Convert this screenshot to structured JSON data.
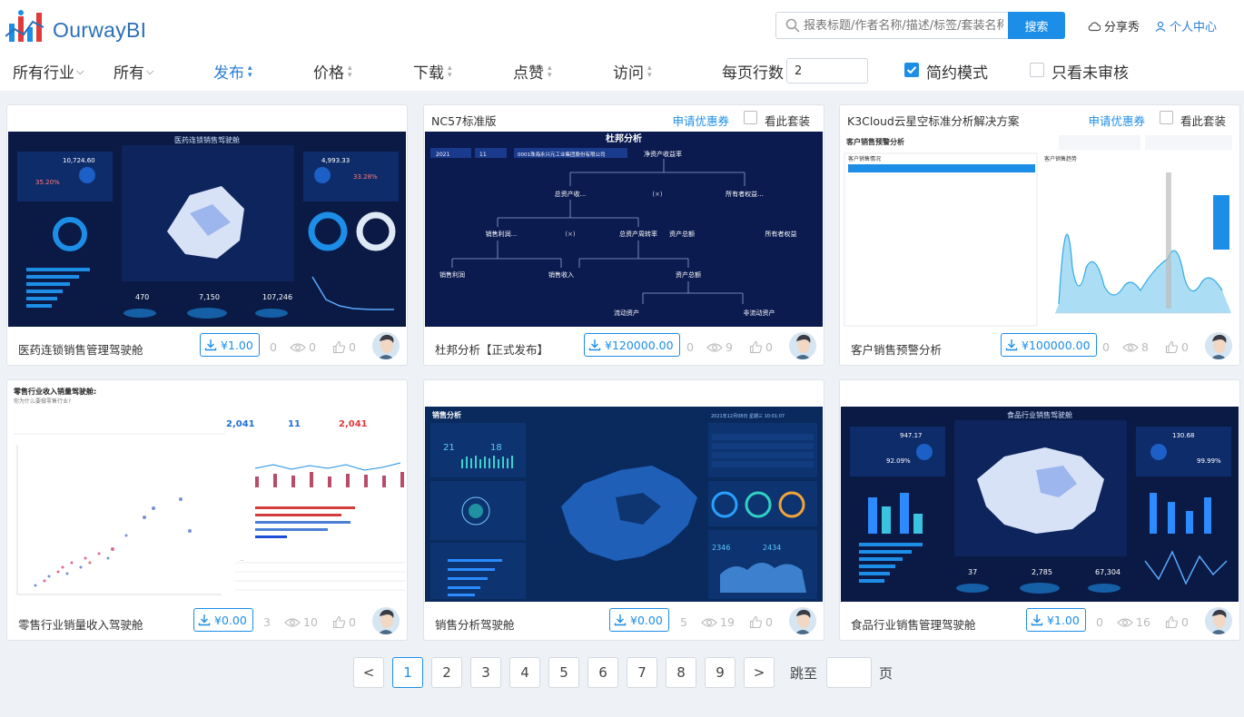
{
  "header": {
    "logo_text": "OurwayBI",
    "search_placeholder": "报表标题/作者名称/描述/标签/套装名称",
    "search_button": "搜索",
    "share_label": "分享秀",
    "personal_label": "个人中心"
  },
  "filters": {
    "industry": "所有行业",
    "all": "所有",
    "publish": "发布",
    "price": "价格",
    "download": "下载",
    "like": "点赞",
    "visit": "访问",
    "rows_label": "每页行数",
    "rows_value": "2",
    "simple_mode": "简约模式",
    "unreviewed": "只看未审核"
  },
  "cards": [
    {
      "header_title": "",
      "coupon": "",
      "see_set": "",
      "name": "医药连锁销售管理驾驶舱",
      "price": "¥1.00",
      "downloads": "0",
      "views": "0",
      "likes": "0"
    },
    {
      "header_title": "NC57标准版",
      "coupon": "申请优惠券",
      "see_set": "看此套装",
      "name": "杜邦分析【正式发布】",
      "price": "¥120000.00",
      "downloads": "0",
      "views": "9",
      "likes": "0"
    },
    {
      "header_title": "K3Cloud云星空标准分析解决方案",
      "coupon": "申请优惠券",
      "see_set": "看此套装",
      "name": "客户销售预警分析",
      "price": "¥100000.00",
      "downloads": "0",
      "views": "8",
      "likes": "0"
    },
    {
      "header_title": "",
      "coupon": "",
      "see_set": "",
      "name": "零售行业销量收入驾驶舱",
      "price": "¥0.00",
      "downloads": "3",
      "views": "10",
      "likes": "0"
    },
    {
      "header_title": "",
      "coupon": "",
      "see_set": "",
      "name": "销售分析驾驶舱",
      "price": "¥0.00",
      "downloads": "5",
      "views": "19",
      "likes": "0"
    },
    {
      "header_title": "",
      "coupon": "",
      "see_set": "",
      "name": "食品行业销售管理驾驶舱",
      "price": "¥1.00",
      "downloads": "0",
      "views": "16",
      "likes": "0"
    }
  ],
  "thumbs": {
    "t1_title": "医药连锁销售驾驶舱",
    "t1_a": "10,724.60",
    "t1_b": "4,993.33",
    "t1_c": "35.20%",
    "t1_d": "33.28%",
    "t1_e": "470",
    "t1_f": "7,150",
    "t1_g": "107,246",
    "t2_title": "杜邦分析",
    "t2_year": "2021",
    "t2_month": "11",
    "t2_company": "0001珠海永兴元工业集团股份有限公司",
    "t2_n1": "净资产收益率",
    "t2_n2": "总资产收...",
    "t2_n3": "所有者权益...",
    "t2_n4": "销售利润...",
    "t2_n5": "总资产周转率",
    "t2_n6": "资产总额",
    "t2_n7": "所有者权益",
    "t2_n8": "销售利润",
    "t2_n9": "销售收入",
    "t2_n10": "资产总额",
    "t2_n11": "流动资产",
    "t2_n12": "非流动资产",
    "t2_op": "(×)",
    "t3_title": "客户销售预警分析",
    "t3_sub1": "客户销售情况",
    "t3_sub2": "客户销售趋势",
    "t4_title": "零售行业收入销量驾驶舱:",
    "t4_sub": "你为什么要做零售行业?",
    "t4_k1": "2,041",
    "t4_k2": "11",
    "t4_k3": "2,041",
    "t5_title": "销售分析",
    "t5_date": "2021年12月08日  星期三  10:01:07",
    "t5_k1": "21",
    "t5_k2": "18",
    "t5_k3": "2346",
    "t5_k4": "2434",
    "t6_title": "食品行业销售驾驶舱",
    "t6_a": "947.17",
    "t6_b": "130.68",
    "t6_c": "92.09%",
    "t6_d": "99.99%",
    "t6_e": "37",
    "t6_f": "2,785",
    "t6_g": "67,304"
  },
  "pagination": {
    "prev": "<",
    "next": ">",
    "pages": [
      "1",
      "2",
      "3",
      "4",
      "5",
      "6",
      "7",
      "8",
      "9"
    ],
    "jump_label": "跳至",
    "page_label": "页"
  },
  "colors": {
    "accent": "#1c8ee8",
    "link": "#2b7fd6",
    "dark_panel": "#0b1d4a"
  }
}
